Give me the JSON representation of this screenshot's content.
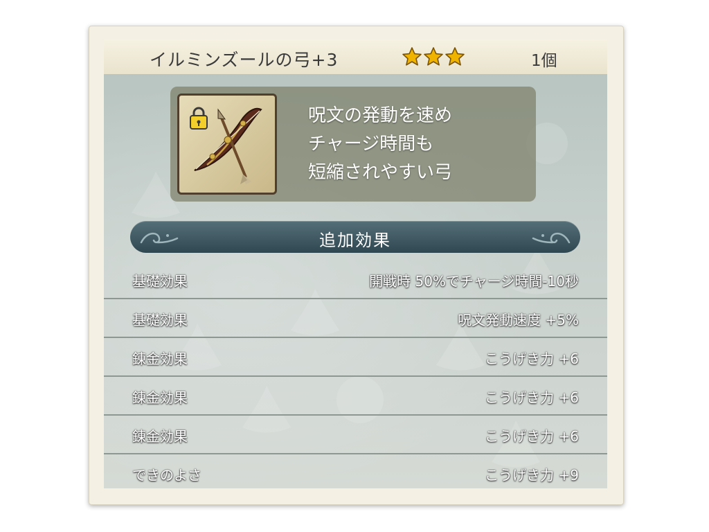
{
  "item": {
    "name": "イルミンズールの弓+3",
    "star_count": 3,
    "quantity": "1個",
    "icon": "bow-and-arrow-icon",
    "locked": true,
    "description_lines": [
      "呪文の発動を速め",
      "チャージ時間も",
      "短縮されやすい弓"
    ]
  },
  "section": {
    "title": "追加効果"
  },
  "effects": [
    {
      "label": "基礎効果",
      "value": "開戦時 50%でチャージ時間-10秒"
    },
    {
      "label": "基礎効果",
      "value": "呪文発動速度 +5%"
    },
    {
      "label": "錬金効果",
      "value": "こうげき力 +6"
    },
    {
      "label": "錬金効果",
      "value": "こうげき力 +6"
    },
    {
      "label": "錬金効果",
      "value": "こうげき力 +6"
    },
    {
      "label": "できのよさ",
      "value": "こうげき力 +9"
    }
  ],
  "colors": {
    "star": "#f0b400",
    "section_bar": "#3d5660",
    "panel": "#bfc9c5"
  }
}
